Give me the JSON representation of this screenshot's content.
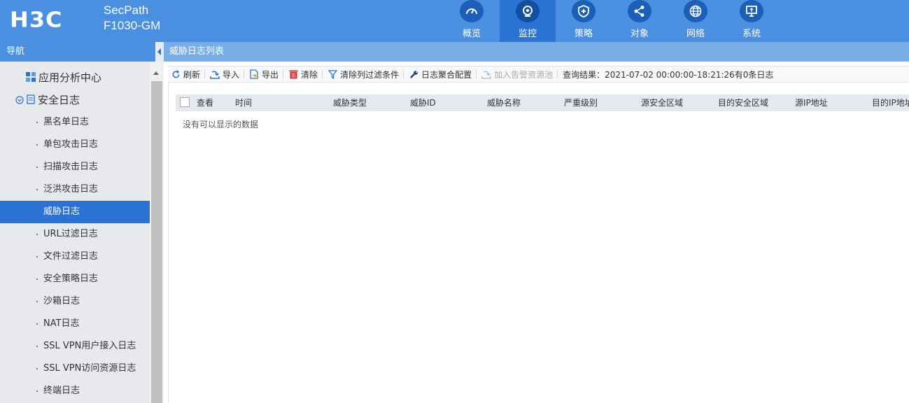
{
  "brand": {
    "logo": "H3C",
    "model_line1": "SecPath",
    "model_line2": "F1030-GM"
  },
  "menu": [
    {
      "label": "概览",
      "icon": "dashboard-icon",
      "active": false
    },
    {
      "label": "监控",
      "icon": "camera-icon",
      "active": true
    },
    {
      "label": "策略",
      "icon": "shield-icon",
      "active": false
    },
    {
      "label": "对象",
      "icon": "share-nodes-icon",
      "active": false
    },
    {
      "label": "网络",
      "icon": "globe-icon",
      "active": false
    },
    {
      "label": "系统",
      "icon": "monitor-icon",
      "active": false
    }
  ],
  "nav": {
    "title": "导航",
    "groups": [
      {
        "label": "应用分析中心",
        "icon": "grid-icon"
      },
      {
        "label": "安全日志",
        "icon": "document-icon"
      }
    ],
    "items": [
      "黑名单日志",
      "单包攻击日志",
      "扫描攻击日志",
      "泛洪攻击日志",
      "威胁日志",
      "URL过滤日志",
      "文件过滤日志",
      "安全策略日志",
      "沙箱日志",
      "NAT日志",
      "SSL VPN用户接入日志",
      "SSL VPN访问资源日志",
      "终端日志"
    ],
    "active_item": "威胁日志"
  },
  "content": {
    "title": "威胁日志列表",
    "toolbar": {
      "refresh": "刷新",
      "import": "导入",
      "export": "导出",
      "clear": "清除",
      "clear_filters": "清除列过滤条件",
      "aggregation": "日志聚合配置",
      "add_alarm_source": "加入告警资源池",
      "query_result": "查询结果：2021-07-02 00:00:00-18:21:26有0条日志"
    },
    "table": {
      "columns": [
        "查看",
        "时间",
        "威胁类型",
        "威胁ID",
        "威胁名称",
        "严重级别",
        "源安全区域",
        "目的安全区域",
        "源IP地址",
        "目的IP地址"
      ],
      "empty_text": "没有可以显示的数据"
    }
  },
  "colors": {
    "header": "#4b8fe0",
    "active": "#2a73d4",
    "sidebar": "#e7e9ec",
    "clear_icon": "#d9302b"
  }
}
